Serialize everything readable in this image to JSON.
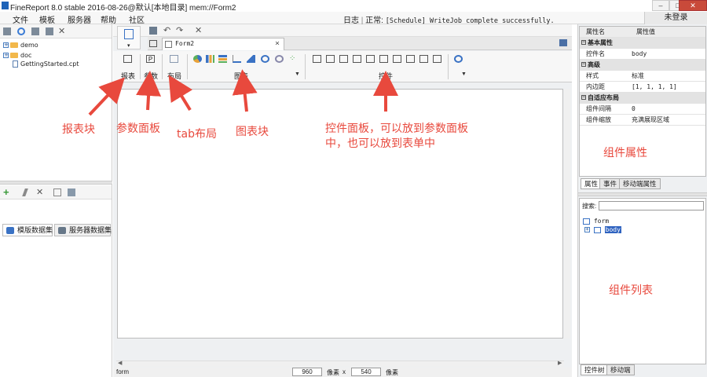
{
  "window": {
    "title": "FineReport 8.0 stable 2016-08-26@默认[本地目录]   mem://Form2",
    "minimize": "–",
    "maximize": "□",
    "close": "✕"
  },
  "menubar": {
    "items": [
      "文件",
      "模板",
      "服务器",
      "帮助",
      "社区"
    ],
    "log_label": "日志",
    "log_status": "正常:",
    "log_text": "[Schedule] WriteJob complete successfully.",
    "login_label": "未登录"
  },
  "left": {
    "tree": [
      {
        "label": "demo",
        "type": "folder"
      },
      {
        "label": "doc",
        "type": "folder"
      },
      {
        "label": "GettingStarted.cpt",
        "type": "file"
      }
    ],
    "dataset_tabs": [
      "模版数据集",
      "服务器数据集"
    ]
  },
  "editor": {
    "file_tab": "Form2",
    "ribbon_groups": {
      "report": "报表",
      "param": "参数",
      "layout": "布局",
      "chart": "图表",
      "widget": "控件"
    },
    "status_left": "form",
    "width_value": "960",
    "height_value": "540",
    "pixel_unit": "像素",
    "times": "x"
  },
  "properties": {
    "col_name": "属性名",
    "col_value": "属性值",
    "rows": [
      {
        "group": "基本属性"
      },
      {
        "key": "控件名",
        "value": "body"
      },
      {
        "group": "高级"
      },
      {
        "key": "样式",
        "value": "标准"
      },
      {
        "key": "内边距",
        "value": "[1, 1, 1, 1]"
      },
      {
        "group": "自适应布局"
      },
      {
        "key": "组件间隔",
        "value": "0"
      },
      {
        "key": "组件缩放",
        "value": "充满展现区域"
      }
    ],
    "tabs": [
      "属性",
      "事件",
      "移动端属性"
    ]
  },
  "widget_tree": {
    "search_label": "搜索:",
    "root": "form",
    "child": "body",
    "tabs": [
      "控件树",
      "移动端"
    ]
  },
  "annotations": {
    "report_block": "报表块",
    "param_panel": "参数面板",
    "tab_layout": "tab布局",
    "chart_block": "图表块",
    "widget_panel_line1": "控件面板，可以放到参数面板",
    "widget_panel_line2": "中，也可以放到表单中",
    "widget_props": "组件属性",
    "widget_list": "组件列表"
  },
  "colors": {
    "annotation": "#e8493d",
    "accent": "#1e63b8"
  }
}
